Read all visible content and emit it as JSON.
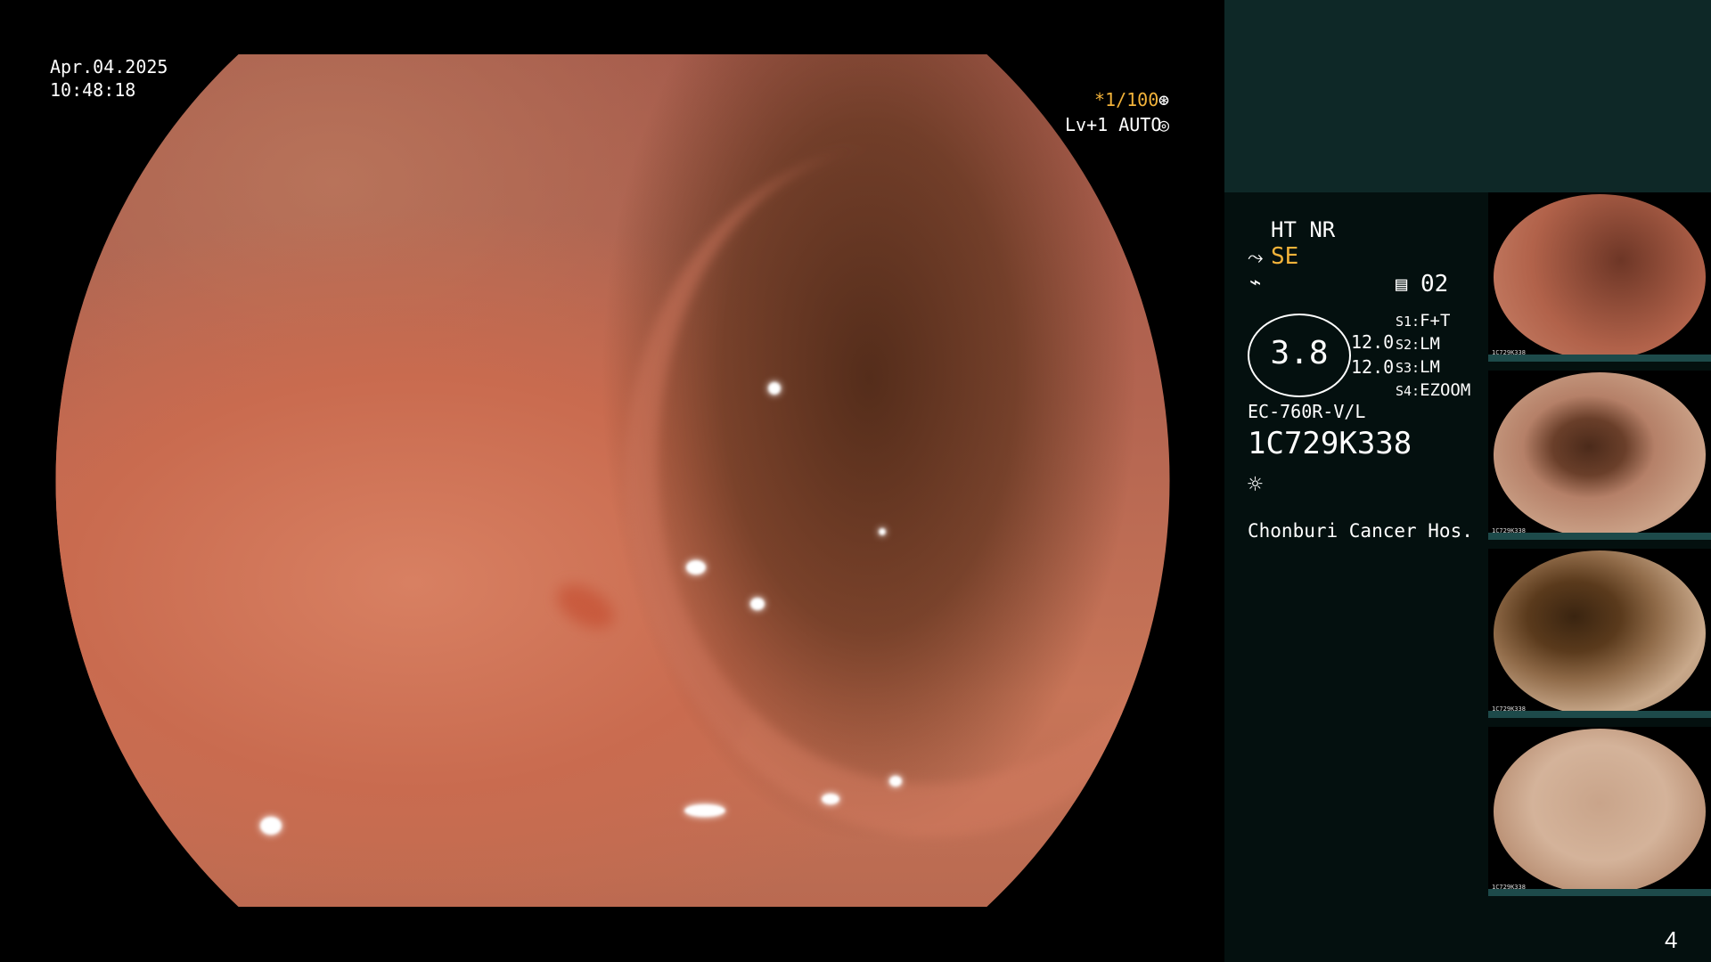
{
  "osd": {
    "date": "Apr.04.2025",
    "time": "10:48:18",
    "shutter": "*1/100",
    "shutter_icon": "aperture-icon",
    "level": "Lv+1 AUTO",
    "level_icon": "iris-icon"
  },
  "panel": {
    "ht_nr": "HT NR",
    "se_label": "SE",
    "se_icon": "scope-hook-icon",
    "freeze_icon": "wave-slash-icon",
    "memory_icon": "memory-icon",
    "memory_value": "02",
    "gauge_value": "3.8",
    "gauge_left_top": "12.0",
    "gauge_left_bottom": "12.0",
    "switches": [
      {
        "key": "S1:",
        "value": "F+T"
      },
      {
        "key": "S2:",
        "value": "LM"
      },
      {
        "key": "S3:",
        "value": "LM"
      },
      {
        "key": "S4:",
        "value": "EZOOM"
      }
    ],
    "scope_model": "EC-760R-V/L",
    "serial": "1C729K338",
    "light_icon": "light-source-icon",
    "hospital": "Chonburi Cancer Hos."
  },
  "thumbnails": [
    {
      "id_text": "1C729K338"
    },
    {
      "id_text": "1C729K338"
    },
    {
      "id_text": "1C729K338"
    },
    {
      "id_text": "1C729K338"
    }
  ],
  "page_number": "4",
  "colors": {
    "panel_bg": "#04100f",
    "panel_top": "#0e2827",
    "accent_yellow": "#f3b33a"
  }
}
